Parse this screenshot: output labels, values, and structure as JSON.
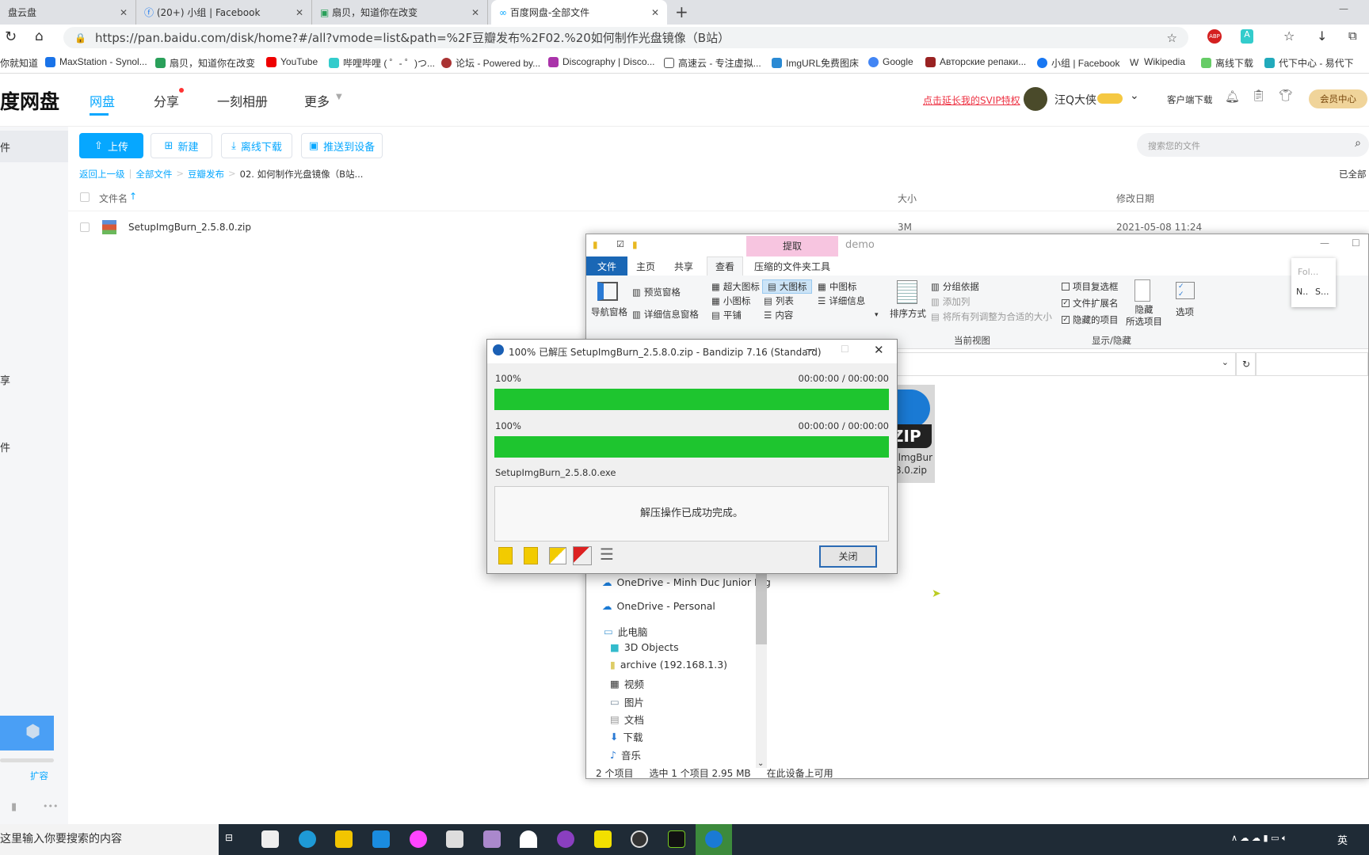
{
  "browser": {
    "tabs": [
      {
        "label": "盘云盘"
      },
      {
        "label": "(20+) 小组 | Facebook"
      },
      {
        "label": "扇贝，知道你在改变"
      },
      {
        "label": "百度网盘-全部文件"
      }
    ],
    "url": "https://pan.baidu.com/disk/home?#/all?vmode=list&path=%2F豆瓣发布%2F02.%20如何制作光盘镜像（B站）",
    "bookmarks": [
      "你就知道",
      "MaxStation - Synol...",
      "扇贝，知道你在改变",
      "YouTube",
      "哔哩哔哩 ( ゜- ゜)つ...",
      "论坛 - Powered by...",
      "Discography | Disco...",
      "高速云 - 专注虚拟...",
      "ImgURL免费图床",
      "Google",
      "Авторские репаки...",
      "小组 | Facebook",
      "Wikipedia",
      "离线下载",
      "代下中心 - 易代下"
    ]
  },
  "baidu": {
    "logo": "度网盘",
    "nav": [
      "网盘",
      "分享",
      "一刻相册",
      "更多"
    ],
    "svip_link": "点击延长我的SVIP特权",
    "username": "汪Q大侠",
    "client_download": "客户端下载",
    "vip_center": "会员中心",
    "sidebar": {
      "item1": "件",
      "item2": "享",
      "item3": "件",
      "expand": "扩容"
    },
    "toolbar": {
      "upload": "上传",
      "new": "新建",
      "offline": "离线下载",
      "push": "推送到设备"
    },
    "search_placeholder": "搜索您的文件",
    "loaded": "已全部",
    "breadcrumb": {
      "back": "返回上一级",
      "all": "全部文件",
      "folder": "豆瓣发布",
      "current": "02. 如何制作光盘镜像（B站..."
    },
    "columns": {
      "name": "文件名",
      "size": "大小",
      "date": "修改日期"
    },
    "files": [
      {
        "name": "SetupImgBurn_2.5.8.0.zip",
        "size": "3M",
        "date": "2021-05-08 11:24"
      }
    ]
  },
  "explorer": {
    "title": "demo",
    "context_tab": "提取",
    "tabs": [
      "文件",
      "主页",
      "共享",
      "查看",
      "压缩的文件夹工具"
    ],
    "ribbon": {
      "nav_pane": "导航窗格",
      "preview": "预览窗格",
      "details_pane": "详细信息窗格",
      "layouts": [
        "超大图标",
        "大图标",
        "中图标",
        "小图标",
        "列表",
        "详细信息",
        "平铺",
        "内容"
      ],
      "sort": "排序方式",
      "group": "分组依据",
      "add_col": "添加列",
      "fit_cols": "将所有列调整为合适的大小",
      "current_view": "当前视图",
      "item_checkbox": "项目复选框",
      "ext": "文件扩展名",
      "hidden_items": "隐藏的项目",
      "hide_selected": "隐藏\n所选项目",
      "show_hide": "显示/隐藏",
      "options": "选项"
    },
    "checks": {
      "item_checkbox": false,
      "ext": true,
      "hidden_items": true
    },
    "file_icon_label": "plmgBur\n.8.0.zip",
    "popup": {
      "title": "Fol...",
      "a": "N..",
      "b": "S..."
    },
    "nav": [
      "OneDrive - Minh Duc Junior Hig",
      "OneDrive - Personal",
      "此电脑",
      "3D Objects",
      "archive (192.168.1.3)",
      "视频",
      "图片",
      "文档",
      "下载",
      "音乐"
    ],
    "status": {
      "count": "2 个项目",
      "selected": "选中 1 个项目  2.95 MB",
      "avail": "在此设备上可用"
    }
  },
  "bandizip": {
    "title": "100% 已解压 SetupImgBurn_2.5.8.0.zip - Bandizip 7.16 (Standard)",
    "progress1": {
      "label": "100%",
      "time": "00:00:00 / 00:00:00",
      "value": 100
    },
    "progress2": {
      "label": "100%",
      "time": "00:00:00 / 00:00:00",
      "value": 100
    },
    "current_file": "SetupImgBurn_2.5.8.0.exe",
    "message": "解压操作已成功完成。",
    "close": "关闭"
  },
  "taskbar": {
    "search_placeholder": "这里输入你要搜索的内容",
    "lang": "英"
  }
}
